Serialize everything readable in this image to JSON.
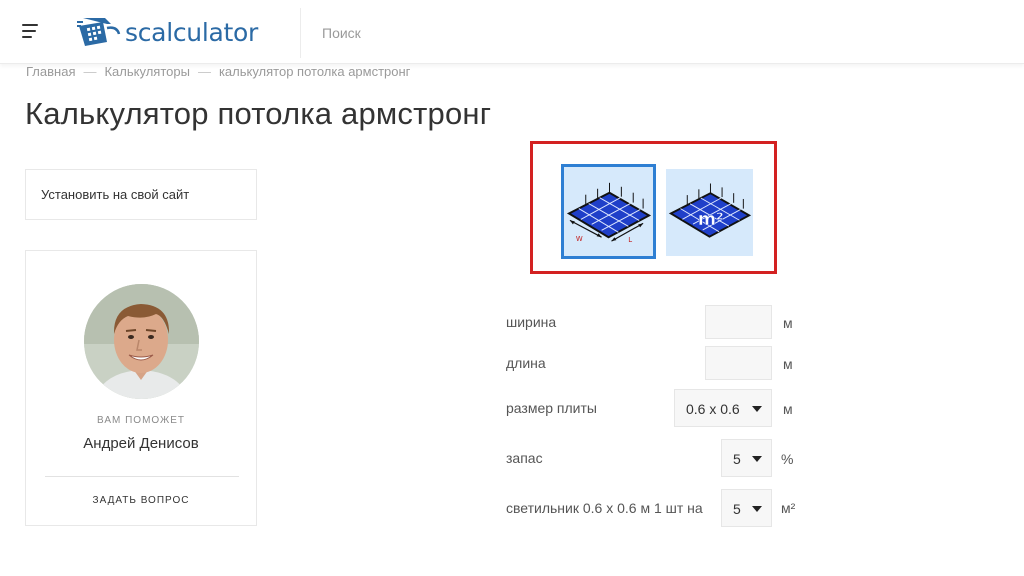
{
  "header": {
    "logo_text": "scalculator",
    "search_placeholder": "Поиск"
  },
  "breadcrumb": {
    "home": "Главная",
    "calculators": "Калькуляторы",
    "current": "калькулятор потолка армстронг",
    "separator": "—"
  },
  "page": {
    "title": "Калькулятор потолка армстронг"
  },
  "sidebar": {
    "install_label": "Установить на свой сайт",
    "helper_label": "ВАМ ПОМОЖЕТ",
    "helper_name": "Андрей Денисов",
    "ask_label": "ЗАДАТЬ ВОПРОС"
  },
  "mode_selector": {
    "modes": [
      {
        "name": "by-dimensions",
        "active": true,
        "icon": "ceiling-dimensions-icon",
        "label_w": "W",
        "label_l": "L"
      },
      {
        "name": "by-area",
        "active": false,
        "icon": "ceiling-area-icon",
        "label": "m²"
      }
    ],
    "frame_color": "#d32121",
    "active_color": "#2e7fd3"
  },
  "form": {
    "width": {
      "label": "ширина",
      "value": "",
      "unit": "м"
    },
    "length": {
      "label": "длина",
      "value": "",
      "unit": "м"
    },
    "tile_size": {
      "label": "размер плиты",
      "value": "0.6 x 0.6",
      "unit": "м"
    },
    "reserve": {
      "label": "запас",
      "value": "5",
      "unit": "%"
    },
    "lamp": {
      "label": "светильник 0.6 x 0.6 м 1 шт на",
      "value": "5",
      "unit": "м²"
    }
  },
  "colors": {
    "brand": "#2b6aa5",
    "tile_blue": "#1f3fc9"
  }
}
